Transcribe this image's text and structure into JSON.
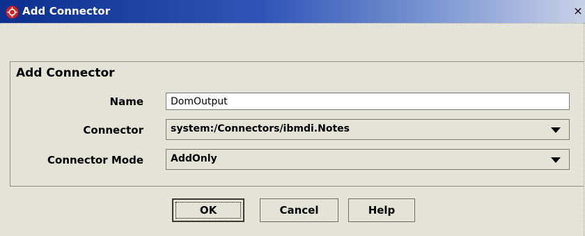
{
  "window": {
    "title": "Add Connector",
    "close_glyph": "×",
    "icon": "app-logo-icon",
    "title_gradient": [
      "#0b2f8f",
      "#c8d1e6"
    ]
  },
  "panel": {
    "title": "Add Connector"
  },
  "form": {
    "name_label": "Name",
    "name_value": "DomOutput",
    "connector_label": "Connector",
    "connector_value": "system:/Connectors/ibmdi.Notes",
    "mode_label": "Connector Mode",
    "mode_value": "AddOnly"
  },
  "buttons": {
    "ok": "OK",
    "cancel": "Cancel",
    "help": "Help"
  },
  "colors": {
    "background": "#e3e3d7",
    "logo": "#d42020"
  }
}
